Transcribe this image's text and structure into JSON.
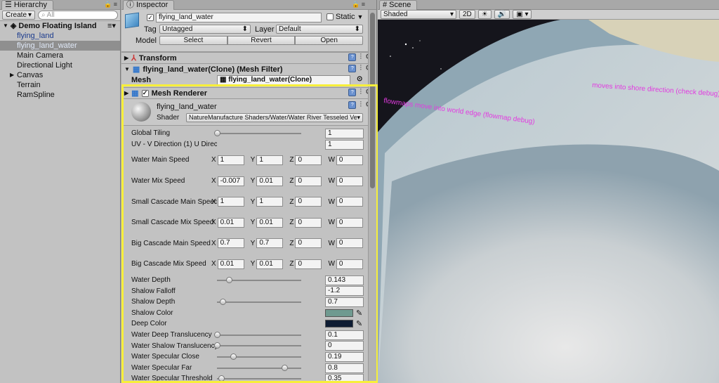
{
  "hierarchy": {
    "tab": "Hierarchy",
    "create": "Create",
    "search_placeholder": "All",
    "root": "Demo Floating Island",
    "items": [
      {
        "label": "flying_land",
        "state": "blue"
      },
      {
        "label": "flying_land_water",
        "state": "selected"
      },
      {
        "label": "Main Camera",
        "state": "normal"
      },
      {
        "label": "Directional Light",
        "state": "normal"
      },
      {
        "label": "Canvas",
        "state": "collapsed"
      },
      {
        "label": "Terrain",
        "state": "normal"
      },
      {
        "label": "RamSpline",
        "state": "normal"
      }
    ]
  },
  "inspector": {
    "tab": "Inspector",
    "object_name": "flying_land_water",
    "static_label": "Static",
    "tag_label": "Tag",
    "tag_value": "Untagged",
    "layer_label": "Layer",
    "layer_value": "Default",
    "model_label": "Model",
    "model_buttons": [
      "Select",
      "Revert",
      "Open"
    ],
    "components": {
      "transform": "Transform",
      "mesh_filter": "flying_land_water(Clone) (Mesh Filter)",
      "mesh_label": "Mesh",
      "mesh_value": "flying_land_water(Clone)",
      "mesh_renderer": "Mesh Renderer"
    },
    "material": {
      "name": "flying_land_water",
      "shader_label": "Shader",
      "shader_value": "NatureManufacture Shaders/Water/Water River Tesseled Ver"
    },
    "properties": [
      {
        "label": "Global Tiling",
        "type": "slider",
        "value": "1",
        "fill": 0.0
      },
      {
        "label": "UV - V Direction (1) U Direction (0)",
        "type": "float",
        "value": "1"
      },
      {
        "label": "Water Main Speed",
        "type": "vector",
        "x": "1",
        "y": "1",
        "z": "0",
        "w": "0"
      },
      {
        "label": "Water Mix Speed",
        "type": "vector",
        "x": "-0.007",
        "y": "0.01",
        "z": "0",
        "w": "0"
      },
      {
        "label": "Small Cascade Main Speed",
        "type": "vector",
        "x": "1",
        "y": "1",
        "z": "0",
        "w": "0"
      },
      {
        "label": "Small Cascade Mix Speed",
        "type": "vector",
        "x": "0.01",
        "y": "0.01",
        "z": "0",
        "w": "0"
      },
      {
        "label": "Big Cascade Main Speed",
        "type": "vector",
        "x": "0.7",
        "y": "0.7",
        "z": "0",
        "w": "0"
      },
      {
        "label": "Big Cascade Mix Speed",
        "type": "vector",
        "x": "0.01",
        "y": "0.01",
        "z": "0",
        "w": "0"
      },
      {
        "label": "Water Depth",
        "type": "slider",
        "value": "0.143",
        "fill": 0.14
      },
      {
        "label": "Shalow Falloff",
        "type": "float",
        "value": "-1.2"
      },
      {
        "label": "Shalow Depth",
        "type": "slider",
        "value": "0.7",
        "fill": 0.07
      },
      {
        "label": "Shalow Color",
        "type": "color",
        "color": "#6f9a90"
      },
      {
        "label": "Deep Color",
        "type": "color",
        "color": "#0e1c33"
      },
      {
        "label": "Water Deep Translucency",
        "type": "slider",
        "value": "0.1",
        "fill": 0.0
      },
      {
        "label": "Water Shalow Translucency",
        "type": "slider",
        "value": "0",
        "fill": 0.0
      },
      {
        "label": "Water Specular Close",
        "type": "slider",
        "value": "0.19",
        "fill": 0.19
      },
      {
        "label": "Water Specular Far",
        "type": "slider",
        "value": "0.8",
        "fill": 0.8
      },
      {
        "label": "Water Specular Threshold",
        "type": "slider",
        "value": "0.35",
        "fill": 0.05
      }
    ]
  },
  "scene": {
    "tab": "Scene",
    "shading": "Shaded",
    "mode_2d": "2D",
    "annotations": [
      "flowmaps move into world edge (flowmap debug)",
      "moves into shore direction (check debug)"
    ]
  },
  "colors": {
    "highlight": "#f7ef3a",
    "annotation": "#e23be0"
  }
}
